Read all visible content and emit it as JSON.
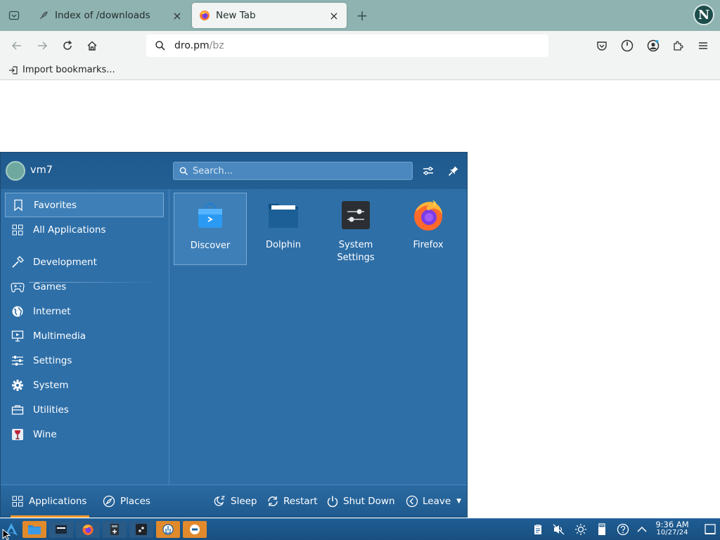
{
  "browser": {
    "tabs": [
      {
        "title": "Index of /downloads",
        "icon": "rocket-icon",
        "active": false
      },
      {
        "title": "New Tab",
        "icon": "firefox-icon",
        "active": true
      }
    ],
    "account_initial": "N",
    "url": {
      "host": "dro.pm",
      "path": "/bz"
    },
    "bookmarks_toolbar": {
      "import_label": "Import bookmarks..."
    }
  },
  "launcher": {
    "username": "vm7",
    "search_placeholder": "Search...",
    "categories": [
      {
        "label": "Favorites",
        "icon": "bookmark-icon",
        "selected": true
      },
      {
        "label": "All Applications",
        "icon": "grid-icon"
      },
      {
        "label": "Development",
        "icon": "hammer-icon"
      },
      {
        "label": "Games",
        "icon": "gamepad-icon"
      },
      {
        "label": "Internet",
        "icon": "globe-icon"
      },
      {
        "label": "Multimedia",
        "icon": "monitor-icon"
      },
      {
        "label": "Settings",
        "icon": "sliders-icon"
      },
      {
        "label": "System",
        "icon": "gear-icon"
      },
      {
        "label": "Utilities",
        "icon": "toolbox-icon"
      },
      {
        "label": "Wine",
        "icon": "wine-glass-icon"
      }
    ],
    "favorites": [
      {
        "label": "Discover",
        "icon": "discover-bag-icon",
        "selected": true
      },
      {
        "label": "Dolphin",
        "icon": "folder-icon"
      },
      {
        "label": "System Settings",
        "icon": "settings-app-icon"
      },
      {
        "label": "Firefox",
        "icon": "firefox-icon"
      }
    ],
    "footer": {
      "tabs": [
        {
          "label": "Applications",
          "icon": "grid-icon",
          "active": true
        },
        {
          "label": "Places",
          "icon": "compass-icon"
        }
      ],
      "actions": [
        {
          "label": "Sleep",
          "icon": "sleep-icon"
        },
        {
          "label": "Restart",
          "icon": "restart-icon"
        },
        {
          "label": "Shut Down",
          "icon": "power-icon"
        },
        {
          "label": "Leave",
          "icon": "leave-icon"
        }
      ]
    }
  },
  "taskbar": {
    "clock_time": "9:36 AM",
    "clock_date": "10/27/24"
  },
  "colors": {
    "launcher_bg": "#2e6fa8",
    "tabbar_bg": "#8fb3b0",
    "accent": "#f39a2f"
  }
}
